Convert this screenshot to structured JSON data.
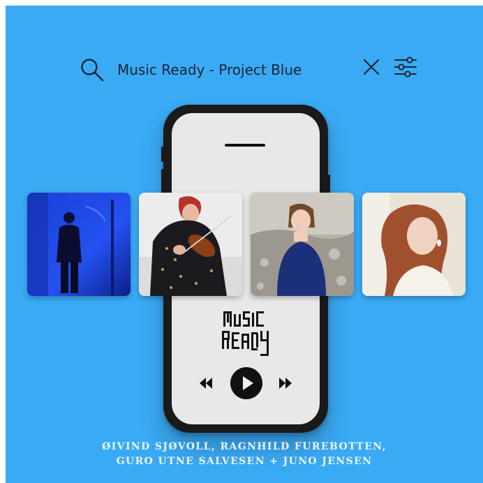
{
  "search": {
    "query": "Music Ready - Project Blue"
  },
  "icons": {
    "search": "search-icon",
    "close": "close-icon",
    "filter": "sliders-icon",
    "rewind": "rewind-icon",
    "play": "play-icon",
    "forward": "fast-forward-icon"
  },
  "logo": {
    "lettering": "MUSIC READY"
  },
  "credits": {
    "line1": "ØIVIND SJØVOLL, RAGNHILD FUREBOTTEN,",
    "line2": "GURO UTNE SALVESEN + JUNO JENSEN"
  },
  "colors": {
    "background": "#3aaaf5",
    "phone_body": "#1a1a1a",
    "phone_screen": "#e8e8e8",
    "text_dark": "#1b2433",
    "credits_text": "#e9f5ff"
  },
  "photos": [
    {
      "subject": "man-in-blue-lit-room"
    },
    {
      "subject": "woman-playing-violin"
    },
    {
      "subject": "woman-in-blue-dress-on-beach"
    },
    {
      "subject": "woman-with-red-hair-portrait"
    }
  ]
}
